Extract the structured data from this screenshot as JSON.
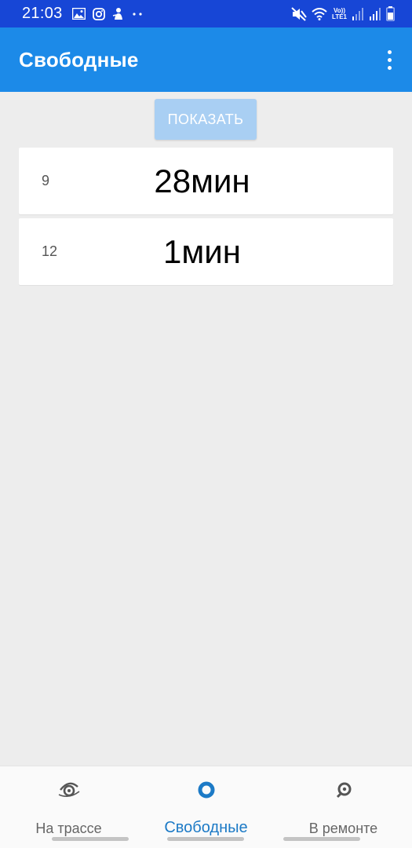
{
  "status_bar": {
    "time": "21:03",
    "lte_top": "Vo))",
    "lte_bottom": "LTE1"
  },
  "app_bar": {
    "title": "Свободные"
  },
  "actions": {
    "show_label": "ПОКАЗАТЬ"
  },
  "items": [
    {
      "id": "9",
      "time": "28мин"
    },
    {
      "id": "12",
      "time": "1мин"
    }
  ],
  "bottom_nav": {
    "items": [
      {
        "label": "На трассе",
        "icon": "on-route-icon",
        "active": false
      },
      {
        "label": "Свободные",
        "icon": "free-icon",
        "active": true
      },
      {
        "label": "В ремонте",
        "icon": "repair-icon",
        "active": false
      }
    ]
  },
  "colors": {
    "status_bar": "#1746d6",
    "app_bar": "#1c8ae8",
    "button_disabled": "#a9cff3",
    "active_nav": "#1c7ac6",
    "background": "#ededed"
  }
}
